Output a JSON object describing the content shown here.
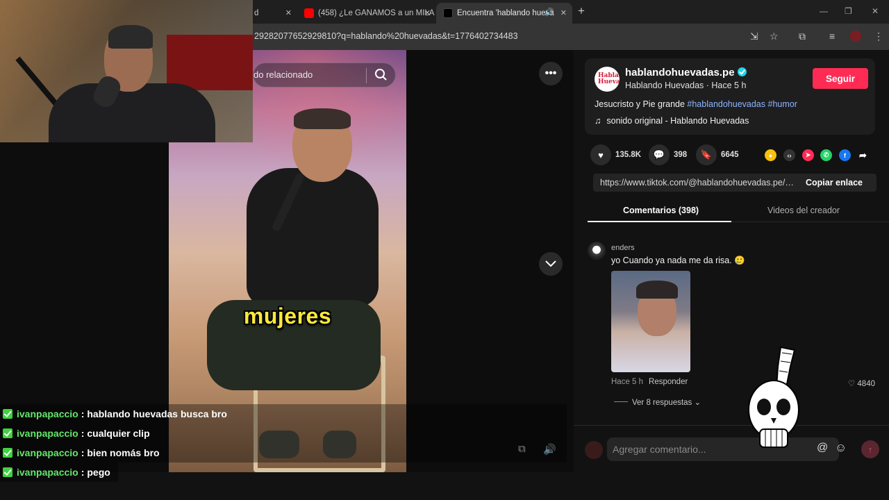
{
  "tabs": [
    {
      "label": "d",
      "active": false
    },
    {
      "label": "(458) ¿Le GANAMOS a un MILA",
      "active": false
    },
    {
      "label": "Encuentra 'hablando hueva",
      "active": true
    }
  ],
  "new_tab": "+",
  "address": {
    "url": "292820776529298​10?q=hablando%20huevadas&t=1776402734483"
  },
  "video": {
    "search_placeholder": "do relacionado",
    "caption": "mujeres"
  },
  "creator": {
    "username": "hablandohuevadas.pe",
    "display_name": "Hablando Huevadas",
    "time": "Hace 5 h",
    "sub_sep": " · ",
    "follow_label": "Seguir",
    "avatar_text": "Hablando Huevadas",
    "description_text": "Jesucristo y Pie grande ",
    "hashtags": [
      "#hablandohuevadas",
      "#humor"
    ],
    "music": "sonido original - Hablando Huevadas"
  },
  "stats": {
    "likes": "135.8K",
    "comments": "398",
    "saves": "6645"
  },
  "share_icons": [
    "embed-icon",
    "send-icon",
    "whatsapp-icon",
    "facebook-icon",
    "share-arrow-icon"
  ],
  "link": {
    "url": "https://www.tiktok.com/@hablandohuevadas.pe/vi...",
    "copy_label": "Copiar enlace"
  },
  "panel_tabs": [
    {
      "label": "Comentarios (398)",
      "active": true
    },
    {
      "label": "Videos del creador",
      "active": false
    }
  ],
  "comment": {
    "user": "enders",
    "text": "yo Cuando ya nada me da risa. 🥲",
    "time": "Hace 5 h",
    "reply": "Responder",
    "likes": "4840",
    "more_replies": "Ver 8 respuestas"
  },
  "comment_input": {
    "placeholder": "Agregar comentario..."
  },
  "chat": [
    {
      "user": "ivanpapaccio",
      "message": "hablando huevadas busca bro"
    },
    {
      "user": "ivanpapaccio",
      "message": "cualquier clip"
    },
    {
      "user": "ivanpapaccio",
      "message": "bien nomás bro"
    },
    {
      "user": "ivanpapaccio",
      "message": "pego"
    }
  ],
  "colors": {
    "accent": "#fe2c55",
    "chat_user": "#63e86b",
    "caption": "#ffe83d",
    "hashtag": "#8fb5ff"
  }
}
